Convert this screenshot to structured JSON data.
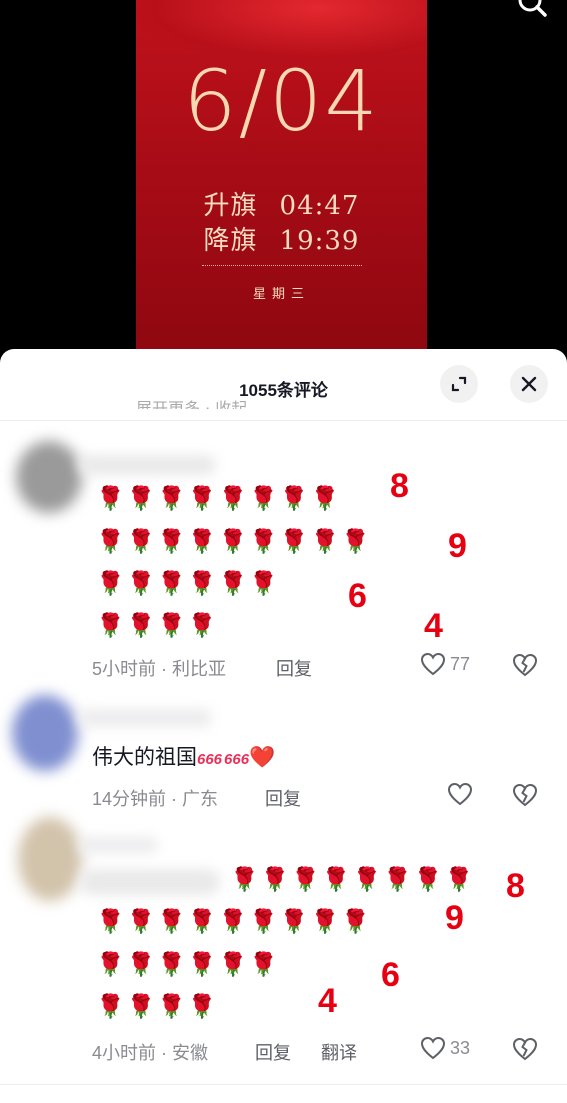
{
  "poster": {
    "date": "6/04",
    "raise_label": "升旗",
    "raise_time": "04:47",
    "lower_label": "降旗",
    "lower_time": "19:39",
    "weekday": "星期三"
  },
  "header": {
    "title": "1055条评论",
    "expand_icon": "expand-icon",
    "close_icon": "close-icon",
    "clipped_text": "展开更多 · 收起"
  },
  "colors": {
    "annotation": "#e60012",
    "poster_red": "#a80c16",
    "date_gold": "#f6d8b2"
  },
  "comments": [
    {
      "rows": [
        "🌹🌹🌹🌹🌹🌹🌹🌹",
        "🌹🌹🌹🌹🌹🌹🌹🌹🌹",
        "🌹🌹🌹🌹🌹🌹",
        "🌹🌹🌹🌹"
      ],
      "annotations": [
        "8",
        "9",
        "6",
        "4"
      ],
      "time": "5小时前",
      "location": "利比亚",
      "reply_label": "回复",
      "likes": "77"
    },
    {
      "text": "伟大的祖国",
      "emoji": "❤️",
      "emoji_names": [
        "666-icon",
        "666-icon",
        "heart-icon"
      ],
      "time": "14分钟前",
      "location": "广东",
      "reply_label": "回复",
      "likes": ""
    },
    {
      "rows": [
        "🌹🌹🌹🌹🌹🌹🌹🌹",
        "🌹🌹🌹🌹🌹🌹🌹🌹🌹",
        "🌹🌹🌹🌹🌹🌹",
        "🌹🌹🌹🌹"
      ],
      "annotations": [
        "8",
        "9",
        "6",
        "4"
      ],
      "time": "4小时前",
      "location": "安徽",
      "reply_label": "回复",
      "translate_label": "翻译",
      "likes": "33"
    }
  ]
}
